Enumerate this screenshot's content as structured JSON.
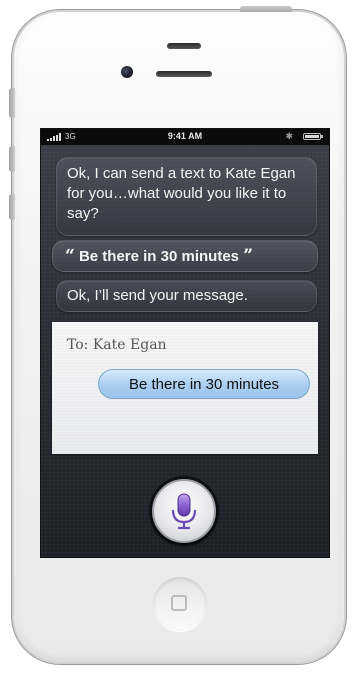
{
  "status_bar": {
    "carrier": "3G",
    "time": "9:41 AM",
    "bluetooth_icon": "bluetooth-icon",
    "battery_icon": "battery-icon",
    "signal_icon": "signal-bars-icon"
  },
  "siri": {
    "response_1": "Ok, I can send a text to Kate Egan for you…what would you like it to say?",
    "user_quote": "Be there in 30 minutes",
    "quote_open": "“",
    "quote_close": "”",
    "response_2": "Ok, I’ll send your message.",
    "mic_icon": "microphone-icon"
  },
  "message_card": {
    "to_label": "To: Kate Egan",
    "message_text": "Be there in 30 minutes"
  },
  "hardware": {
    "home_icon": "home-button-icon"
  },
  "colors": {
    "siri_mic": "#8a63d2",
    "sms_bubble": "#a9cdf0",
    "screen_background": "#2a2d35"
  }
}
